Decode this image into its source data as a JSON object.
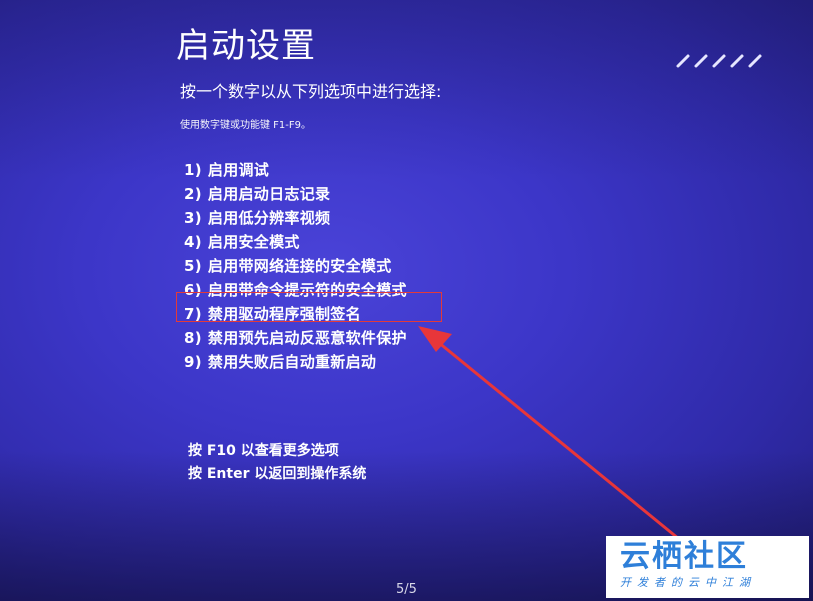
{
  "screen": {
    "title": "启动设置",
    "subtitle": "按一个数字以从下列选项中进行选择:",
    "hint": "使用数字键或功能键 F1-F9。",
    "options": [
      {
        "num": "1)",
        "label": "启用调试"
      },
      {
        "num": "2)",
        "label": "启用启动日志记录"
      },
      {
        "num": "3)",
        "label": "启用低分辨率视频"
      },
      {
        "num": "4)",
        "label": "启用安全模式"
      },
      {
        "num": "5)",
        "label": "启用带网络连接的安全模式"
      },
      {
        "num": "6)",
        "label": "启用带命令提示符的安全模式"
      },
      {
        "num": "7)",
        "label": "禁用驱动程序强制签名"
      },
      {
        "num": "8)",
        "label": "禁用预先启动反恶意软件保护"
      },
      {
        "num": "9)",
        "label": "禁用失败后自动重新启动"
      }
    ],
    "footer": {
      "more_options": "按 F10 以查看更多选项",
      "return": "按 Enter 以返回到操作系统"
    },
    "highlighted_option": 7
  },
  "page_counter": "5/5",
  "watermark": {
    "brand": "云栖社区",
    "tagline": "开发者的云中江湖"
  },
  "colors": {
    "background": "#3c36c8",
    "text": "#ffffff",
    "annotation": "#e23a3a",
    "watermark_text": "#2e7fd9"
  }
}
